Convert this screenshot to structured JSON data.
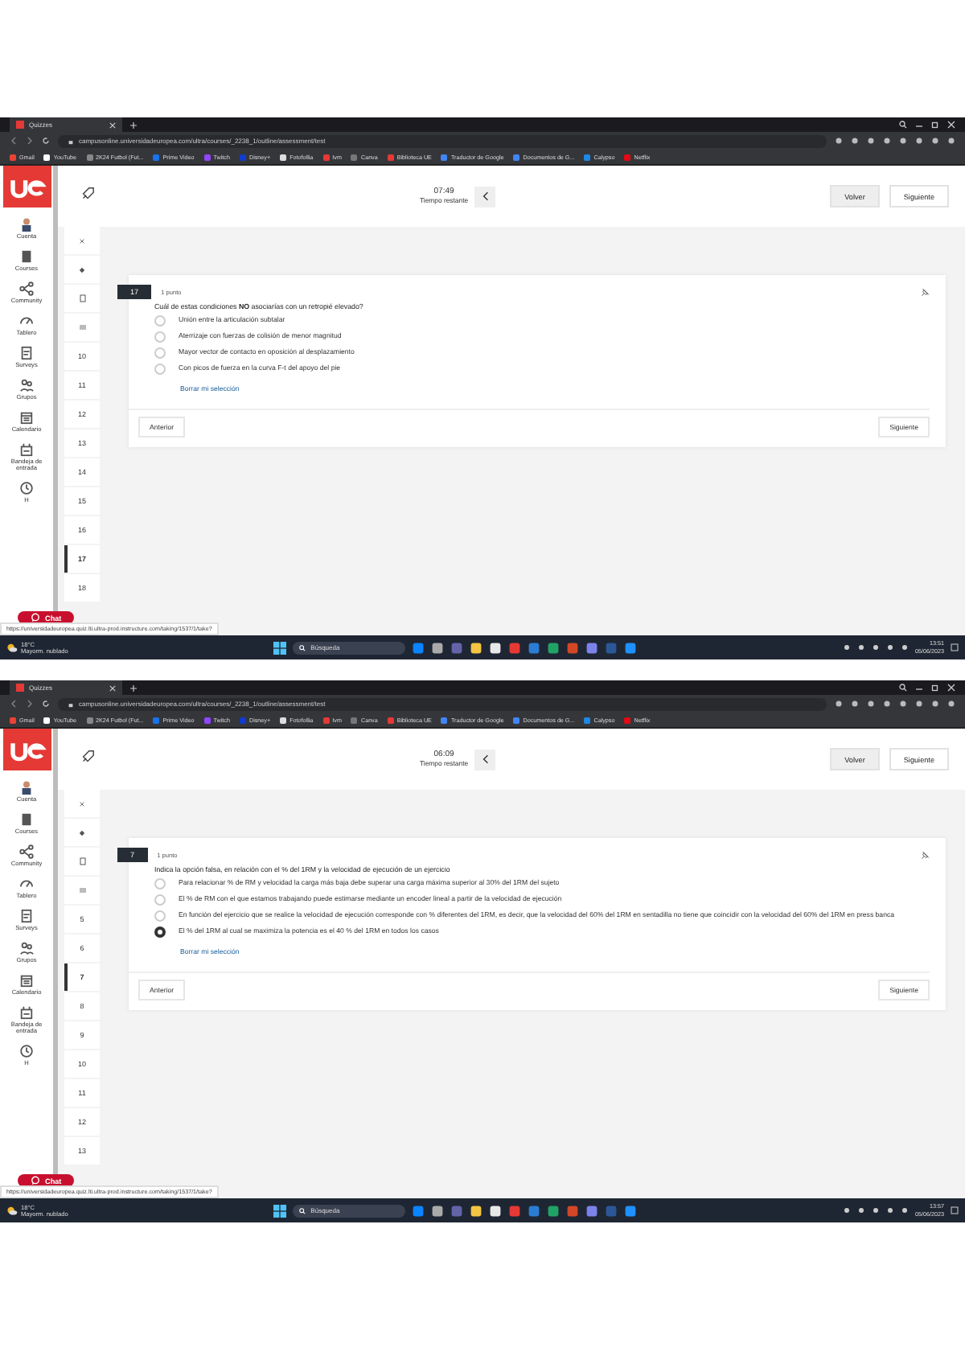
{
  "screenshots": [
    {
      "browser_tab": "Quizzes",
      "url": "campusonline.universidadeuropea.com/ultra/courses/_2238_1/outline/assessment/test",
      "bookmarks": [
        "Gmail",
        "YouTube",
        "2K24 Futbol (Fut...",
        "Prime Video",
        "Twitch",
        "Disney+",
        "Fotofollia",
        "Ivm",
        "Canva",
        "Biblioteca UE",
        "Traductor de Google",
        "Documentos de G...",
        "Calypso",
        "Netflix"
      ],
      "timer": "07:49",
      "timer_label": "Tiempo restante",
      "header_buttons": [
        "Volver",
        "Siguiente"
      ],
      "nav_items": [
        "Cuenta",
        "Courses",
        "Community",
        "Tablero",
        "Surveys",
        "Grupos",
        "Calendario",
        "Bandeja de entrada",
        "H"
      ],
      "question_numbers": [
        {
          "label": "10",
          "selected": false
        },
        {
          "label": "11",
          "selected": false
        },
        {
          "label": "12",
          "selected": false
        },
        {
          "label": "13",
          "selected": false
        },
        {
          "label": "14",
          "selected": false
        },
        {
          "label": "15",
          "selected": false
        },
        {
          "label": "16",
          "selected": false
        },
        {
          "label": "17",
          "selected": true
        },
        {
          "label": "18",
          "selected": false
        }
      ],
      "question": {
        "number": "17",
        "points": "1 punto",
        "text": "Cuál de estas condiciones **NO** asociarías con un retropié elevado?",
        "options": [
          {
            "text": "Unión entre la articulación subtalar",
            "selected": false
          },
          {
            "text": "Aterrizaje con fuerzas de colisión de menor magnitud",
            "selected": false
          },
          {
            "text": "Mayor vector de contacto en oposición al desplazamiento",
            "selected": false
          },
          {
            "text": "Con picos de fuerza en la curva F-t del apoyo del pie",
            "selected": false
          }
        ],
        "clear_link": "Borrar mi selección"
      },
      "footer_buttons": [
        "Anterior",
        "Siguiente"
      ],
      "chat": "Chat",
      "status_url": "https://universidadeuropea.quiz.lti.ultra-prod.instructure.com/taking/1537/1/take?",
      "taskbar": {
        "weather": "18°C",
        "weather_note": "Mayorm. nublado",
        "search": "Búsqueda",
        "time": "13:51",
        "date": "05/06/2023"
      }
    },
    {
      "browser_tab": "Quizzes",
      "url": "campusonline.universidadeuropea.com/ultra/courses/_2238_1/outline/assessment/test",
      "bookmarks": [
        "Gmail",
        "YouTube",
        "2K24 Futbol (Fut...",
        "Prime Video",
        "Twitch",
        "Disney+",
        "Fotofollia",
        "Ivm",
        "Canva",
        "Biblioteca UE",
        "Traductor de Google",
        "Documentos de G...",
        "Calypso",
        "Netflix"
      ],
      "timer": "06:09",
      "timer_label": "Tiempo restante",
      "header_buttons": [
        "Volver",
        "Siguiente"
      ],
      "nav_items": [
        "Cuenta",
        "Courses",
        "Community",
        "Tablero",
        "Surveys",
        "Grupos",
        "Calendario",
        "Bandeja de entrada",
        "H"
      ],
      "question_numbers": [
        {
          "label": "5",
          "selected": false
        },
        {
          "label": "6",
          "selected": false
        },
        {
          "label": "7",
          "selected": true
        },
        {
          "label": "8",
          "selected": false
        },
        {
          "label": "9",
          "selected": false
        },
        {
          "label": "10",
          "selected": false
        },
        {
          "label": "11",
          "selected": false
        },
        {
          "label": "12",
          "selected": false
        },
        {
          "label": "13",
          "selected": false
        }
      ],
      "question": {
        "number": "7",
        "points": "1 punto",
        "text": "Indica la opción falsa, en relación con el % del 1RM y la velocidad de ejecución de un ejercicio",
        "options": [
          {
            "text": "Para relacionar % de RM y velocidad la carga más baja debe superar una carga máxima superior al 30% del 1RM del sujeto",
            "selected": false
          },
          {
            "text": "El % de RM con el que estamos trabajando puede estimarse mediante un encoder lineal a partir de la velocidad de ejecución",
            "selected": false
          },
          {
            "text": "En función del ejercicio que se realice la velocidad de ejecución corresponde con % diferentes del 1RM, es decir, que la velocidad del 60% del 1RM en sentadilla no tiene que coincidir con la velocidad del 60% del 1RM en press banca",
            "selected": false
          },
          {
            "text": "El % del 1RM al cual se maximiza la potencia es el 40 % del 1RM en todos los casos",
            "selected": true
          }
        ],
        "clear_link": "Borrar mi selección"
      },
      "footer_buttons": [
        "Anterior",
        "Siguiente"
      ],
      "chat": "Chat",
      "status_url": "https://universidadeuropea.quiz.lti.ultra-prod.instructure.com/taking/1537/1/take?",
      "taskbar": {
        "weather": "18°C",
        "weather_note": "Mayorm. nublado",
        "search": "Búsqueda",
        "time": "13:57",
        "date": "05/06/2023"
      }
    }
  ]
}
